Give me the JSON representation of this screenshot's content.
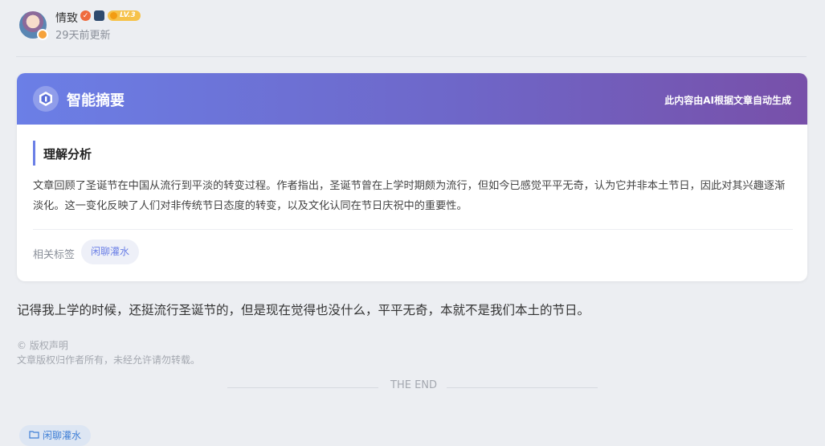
{
  "author": {
    "name": "情致",
    "level": "LV.3",
    "update_time": "29天前更新"
  },
  "summary_card": {
    "title": "智能摘要",
    "note": "此内容由AI根据文章自动生成",
    "section_title": "理解分析",
    "summary": "文章回顾了圣诞节在中国从流行到平淡的转变过程。作者指出，圣诞节曾在上学时期颇为流行，但如今已感觉平平无奇，认为它并非本土节日，因此对其兴趣逐渐淡化。这一变化反映了人们对非传统节日态度的转变，以及文化认同在节日庆祝中的重要性。",
    "tags_label": "相关标签",
    "tag": "闲聊灌水"
  },
  "article": {
    "body": "记得我上学的时候，还挺流行圣诞节的，但是现在觉得也没什么，平平无奇，本就不是我们本土的节日。"
  },
  "copyright": {
    "title": "© 版权声明",
    "text": "文章版权归作者所有，未经允许请勿转载。"
  },
  "end_text": "THE END",
  "bottom_tag": "闲聊灌水",
  "colors": {
    "accent": "#6b7fe6",
    "gradient_end": "#7850a9",
    "tag_blue": "#3f7fd6"
  },
  "icons": [
    "verified-icon",
    "medal-icon",
    "level-badge-icon",
    "ai-summary-icon",
    "folder-icon"
  ]
}
